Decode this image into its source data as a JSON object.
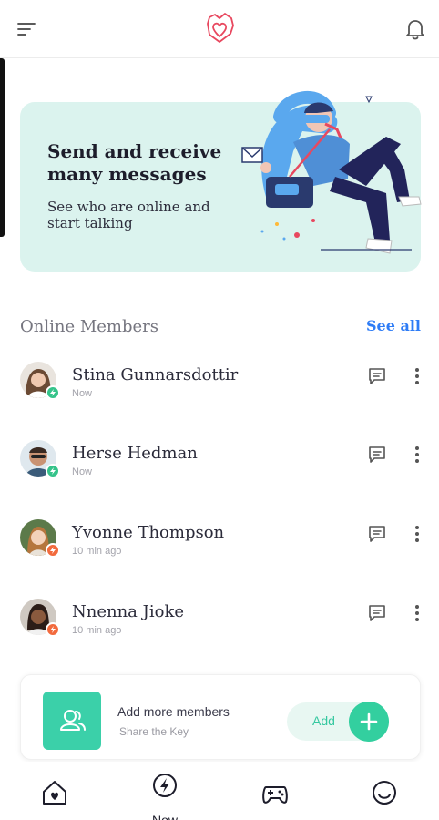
{
  "topbar": {
    "menu_icon": "menu-icon",
    "logo_icon": "heart-logo-icon",
    "bell_icon": "bell-icon"
  },
  "banner": {
    "title": "Send and receive many messages",
    "subtitle": "See who are online and start talking"
  },
  "online_section": {
    "title": "Online Members",
    "see_all": "See all"
  },
  "members": [
    {
      "name": "Stina Gunnarsdottir",
      "status": "Now",
      "status_color": "#35c38a"
    },
    {
      "name": "Herse Hedman",
      "status": "Now",
      "status_color": "#35c38a"
    },
    {
      "name": "Yvonne Thompson",
      "status": "10 min ago",
      "status_color": "#f26a3d"
    },
    {
      "name": "Nnenna Jioke",
      "status": "10 min ago",
      "status_color": "#f26a3d"
    }
  ],
  "add_card": {
    "title": "Add more members",
    "subtitle": "Share the Key",
    "button_label": "Add"
  },
  "bottom_nav": {
    "items": [
      {
        "icon": "home-heart-icon",
        "label": ""
      },
      {
        "icon": "bolt-icon",
        "label": "Now"
      },
      {
        "icon": "gamepad-icon",
        "label": ""
      },
      {
        "icon": "smile-icon",
        "label": ""
      }
    ]
  },
  "colors": {
    "accent": "#2e7cf6",
    "teal": "#33cf9f",
    "banner_bg": "#dbf3ee",
    "online": "#35c38a",
    "away": "#f26a3d"
  }
}
